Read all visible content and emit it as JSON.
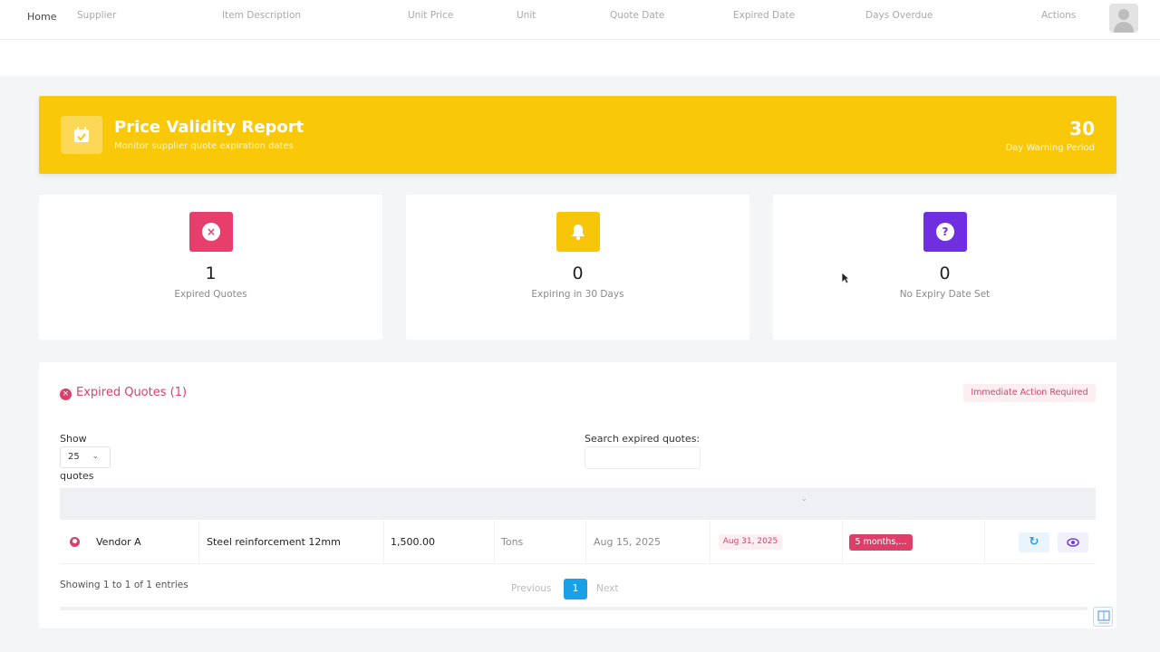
{
  "nav": {
    "breadcrumb": "Home"
  },
  "banner": {
    "title": "Price Validity Report",
    "subtitle": "Monitor supplier quote expiration dates",
    "warning_days": "30",
    "warning_label": "Day Warning Period"
  },
  "stats": [
    {
      "value": "1",
      "label": "Expired Quotes",
      "icon": "close-circle-icon",
      "color": "#e83e6c"
    },
    {
      "value": "0",
      "label": "Expiring in 30 Days",
      "icon": "bell-icon",
      "color": "#f7c608"
    },
    {
      "value": "0",
      "label": "No Expiry Date Set",
      "icon": "question-icon",
      "color": "#6f2fe0"
    }
  ],
  "expired_panel": {
    "title": "Expired Quotes (1)",
    "badge": "Immediate Action Required",
    "show_label": "Show",
    "page_size": "25",
    "entries_suffix": "quotes",
    "search_label": "Search expired quotes:",
    "search_value": "",
    "columns": [
      "Supplier",
      "Item Description",
      "Unit Price",
      "Unit",
      "Quote Date",
      "Expired Date",
      "Days Overdue",
      "Actions"
    ],
    "rows": [
      {
        "supplier": "Vendor A",
        "item": "Steel reinforcement 12mm",
        "unit_price": "1,500.00",
        "unit": "Tons",
        "quote_date": "Aug 15, 2025",
        "expired_date": "Aug 31, 2025",
        "days_overdue": "5 months,..."
      }
    ],
    "showing_text": "Showing 1 to 1 of 1 entries",
    "pagination": {
      "previous": "Previous",
      "current": "1",
      "next": "Next"
    }
  },
  "colors": {
    "accent_yellow": "#f9c808",
    "danger": "#e03e6a",
    "info": "#1aa0e6",
    "purple": "#6f3ce0"
  }
}
